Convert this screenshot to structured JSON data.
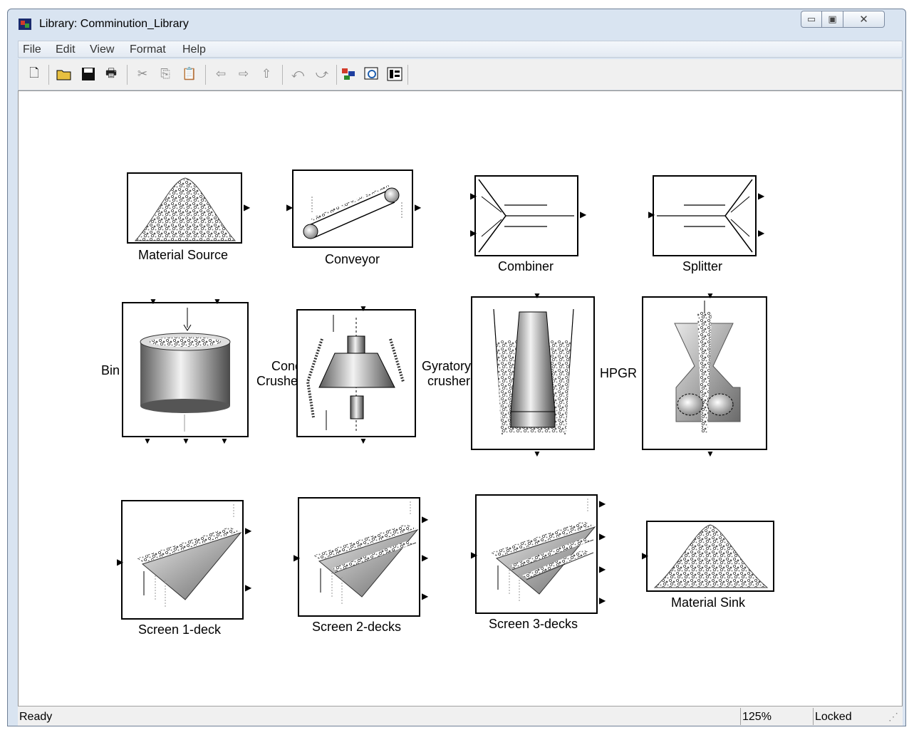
{
  "window": {
    "title": "Library: Comminution_Library"
  },
  "menu": [
    "File",
    "Edit",
    "View",
    "Format",
    "Help"
  ],
  "toolbar": {
    "new_icon": "new-file-icon",
    "open_icon": "open-folder-icon",
    "save_icon": "save-icon",
    "print_icon": "print-icon",
    "cut_icon": "cut-icon",
    "copy_icon": "copy-icon",
    "paste_icon": "paste-icon",
    "back_icon": "back-arrow-icon",
    "forward_icon": "forward-arrow-icon",
    "up_icon": "up-arrow-icon",
    "undo_icon": "undo-icon",
    "redo_icon": "redo-icon",
    "library_icon": "library-browser-icon",
    "explorer_icon": "model-explorer-icon",
    "debug_icon": "debugger-icon"
  },
  "blocks": {
    "material_source": "Material Source",
    "conveyor": "Conveyor",
    "combiner": "Combiner",
    "splitter": "Splitter",
    "bin": "Bin",
    "cone_crusher_line1": "Cone",
    "cone_crusher_line2": "Crusher",
    "gyratory_line1": "Gyratory",
    "gyratory_line2": "crusher",
    "hpgr": "HPGR",
    "screen1": "Screen 1-deck",
    "screen2": "Screen 2-decks",
    "screen3": "Screen 3-decks",
    "material_sink": "Material Sink"
  },
  "status": {
    "text": "Ready",
    "zoom": "125%",
    "mode": "Locked"
  },
  "colors": {
    "window_frame": "#d9e4f1",
    "canvas": "#ffffff",
    "block_border": "#000000"
  }
}
